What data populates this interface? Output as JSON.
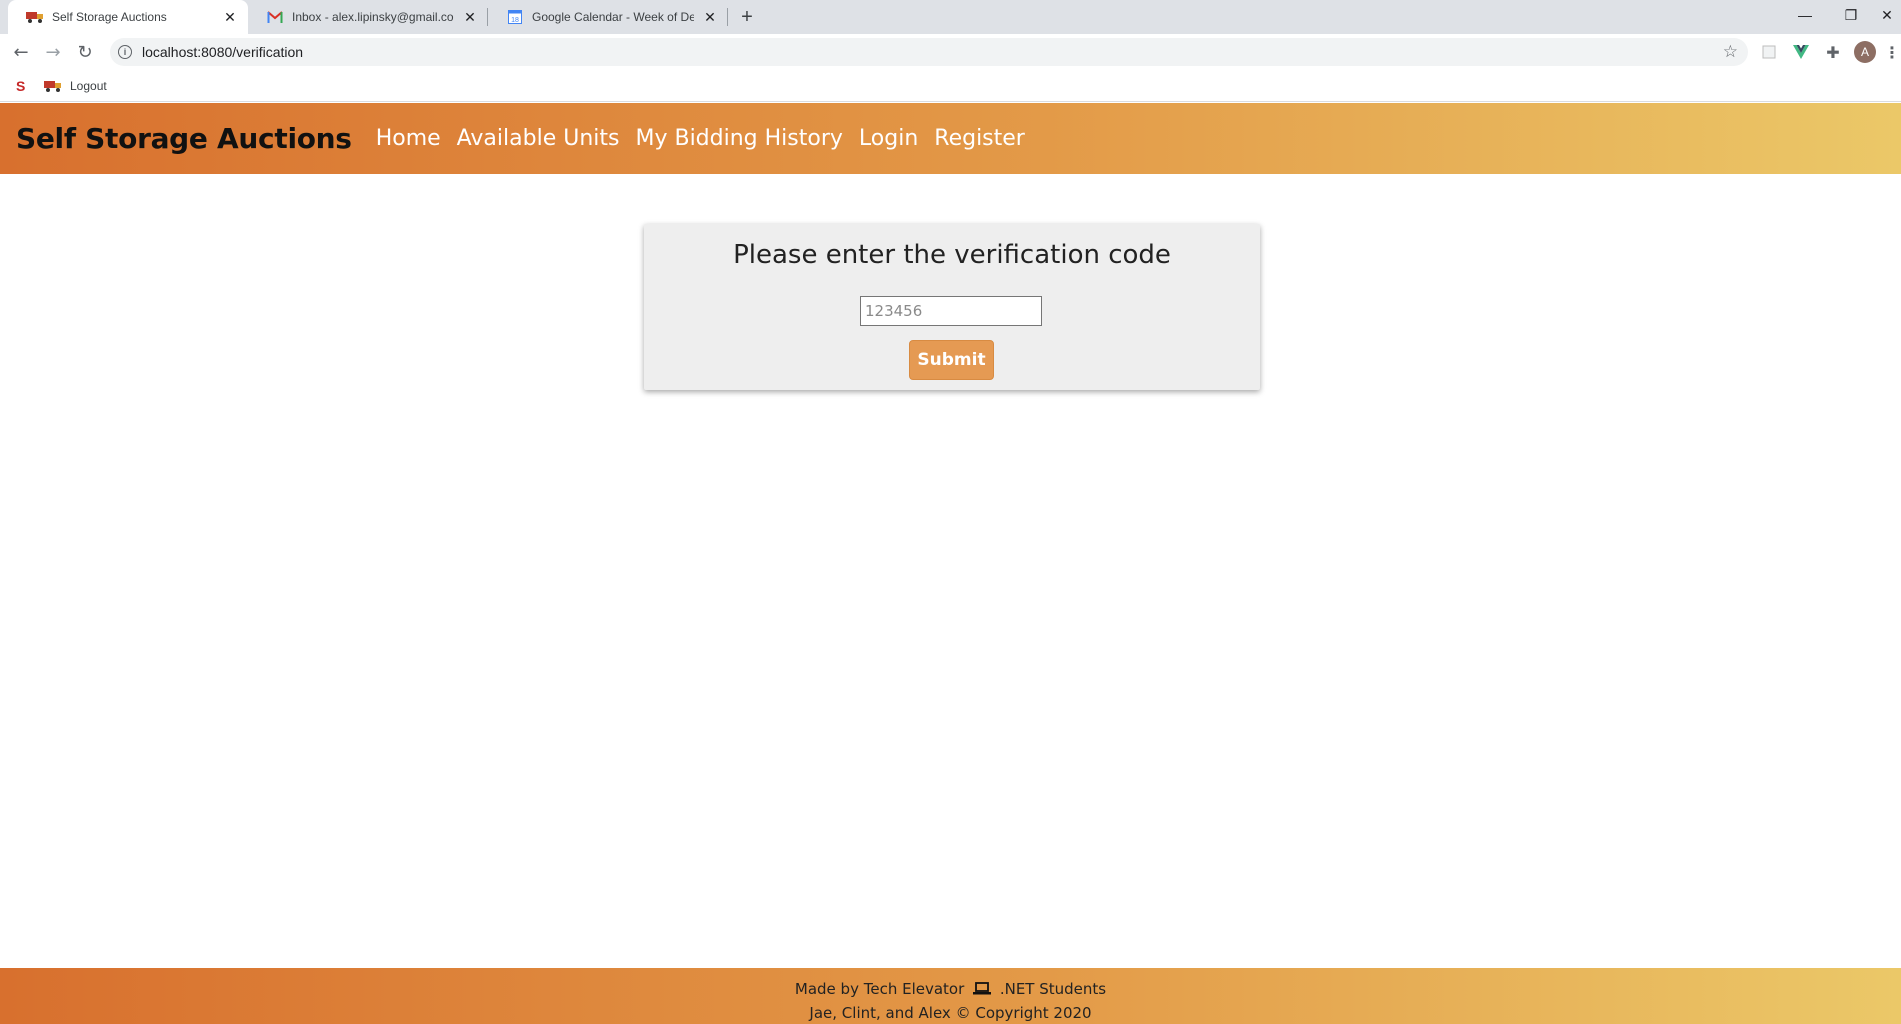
{
  "browser": {
    "tabs": [
      {
        "title": "Self Storage Auctions",
        "active": true,
        "favicon": "truck-icon"
      },
      {
        "title": "Inbox - alex.lipinsky@gmail.com",
        "active": false,
        "favicon": "gmail-icon"
      },
      {
        "title": "Google Calendar - Week of Dece",
        "active": false,
        "favicon": "calendar-icon"
      }
    ],
    "new_tab_label": "+",
    "url": "localhost:8080/verification",
    "profile_initial": "A",
    "bookmarks": [
      {
        "label": "",
        "icon": "s-logo-icon"
      },
      {
        "label": "Logout",
        "icon": "truck-icon"
      }
    ]
  },
  "site": {
    "brand": "Self Storage Auctions",
    "nav": [
      "Home",
      "Available Units",
      "My Bidding History",
      "Login",
      "Register"
    ],
    "accent_colors": {
      "header_start": "#d8702e",
      "header_end": "#ebc868",
      "button": "#e59a53"
    }
  },
  "verification": {
    "heading": "Please enter the verification code",
    "input_placeholder": "123456",
    "input_value": "",
    "submit_label": "Submit"
  },
  "footer": {
    "line1_prefix": "Made by Tech Elevator",
    "line1_suffix": ".NET Students",
    "names": [
      "Jae",
      "Clint",
      "Alex"
    ],
    "sep1": ", ",
    "sep2": ", and ",
    "copyright": "© Copyright 2020"
  }
}
